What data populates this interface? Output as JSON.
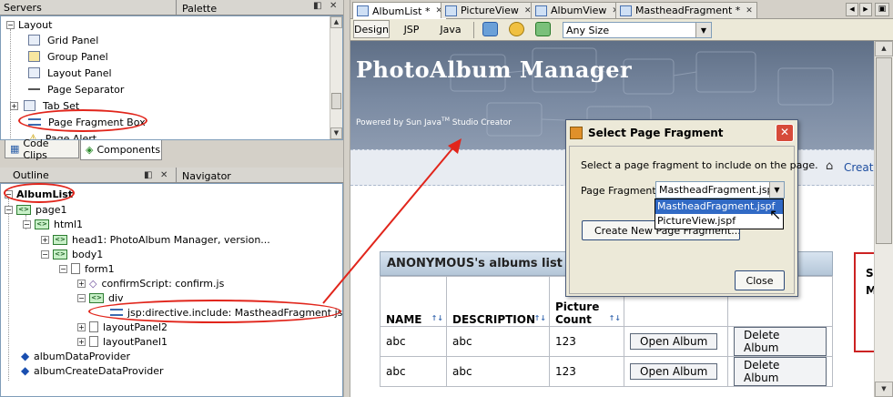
{
  "palette": {
    "servers_tab": "Servers",
    "palette_tab": "Palette",
    "section": "Layout",
    "items": [
      "Grid Panel",
      "Group Panel",
      "Layout Panel",
      "Page Separator",
      "Tab Set",
      "Page Fragment Box",
      "Page Alert"
    ],
    "bottom_tabs": [
      "Code Clips",
      "Components"
    ]
  },
  "outline": {
    "outline_tab": "Outline",
    "navigator_tab": "Navigator",
    "root": "AlbumList",
    "nodes": [
      "page1",
      "html1",
      "head1: PhotoAlbum Manager, version...",
      "body1",
      "form1",
      "confirmScript: confirm.js",
      "div",
      "jsp:directive.include: MastheadFragment.jspf",
      "layoutPanel2",
      "layoutPanel1",
      "albumDataProvider",
      "albumCreateDataProvider"
    ]
  },
  "editor": {
    "tabs": [
      "AlbumList *",
      "PictureView",
      "AlbumView",
      "MastheadFragment *"
    ],
    "modes": [
      "Design",
      "JSP",
      "Java"
    ],
    "size_select": "Any Size"
  },
  "page": {
    "masthead_title": "PhotoAlbum Manager",
    "masthead_sub": "Powered by Sun Java",
    "masthead_tm": "TM",
    "masthead_sub2": "Studio Creator",
    "creator_link": "Creat",
    "side_letters": [
      "S",
      "M"
    ],
    "table_title": "ANONYMOUS's albums list",
    "columns": [
      "NAME",
      "DESCRIPTION",
      "Picture Count"
    ],
    "rows": [
      {
        "name": "abc",
        "description": "abc",
        "count": "123",
        "open": "Open Album",
        "delete": "Delete Album"
      },
      {
        "name": "abc",
        "description": "abc",
        "count": "123",
        "open": "Open Album",
        "delete": "Delete Album"
      }
    ]
  },
  "dialog": {
    "title": "Select Page Fragment",
    "prompt": "Select a page fragment to include on the page.",
    "field_label": "Page Fragment:",
    "selected": "MastheadFragment.jspf",
    "options": [
      "MastheadFragment.jspf",
      "PictureView.jspf"
    ],
    "create_button": "Create New Page Fragment...",
    "close_button": "Close"
  },
  "colors": {
    "annotation_red": "#e1251b",
    "selection_blue": "#316ac5",
    "masthead": "#6f7f97"
  }
}
